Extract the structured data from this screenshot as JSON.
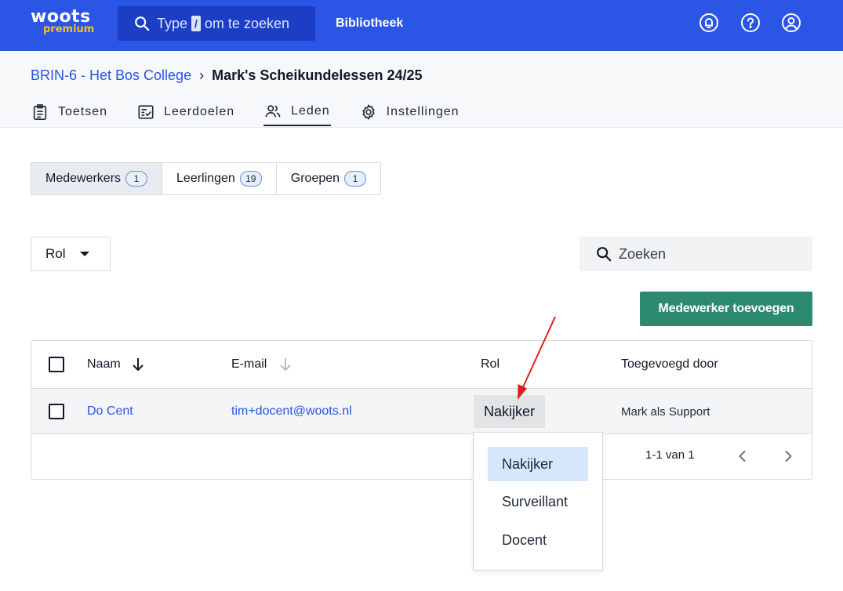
{
  "topbar": {
    "logo_main": "woots",
    "logo_sub": "premium",
    "search_prefix": "Type",
    "search_key": "/",
    "search_suffix": "om te zoeken",
    "nav_link": "Bibliotheek",
    "icons": [
      "notification-bell-icon",
      "help-icon",
      "account-icon"
    ]
  },
  "breadcrumb": {
    "parent": "BRIN-6 - Het Bos College",
    "separator": "›",
    "current": "Mark's Scheikundelessen 24/25"
  },
  "tabs": [
    {
      "label": "Toetsen",
      "icon": "clipboard-icon"
    },
    {
      "label": "Leerdoelen",
      "icon": "checklist-icon"
    },
    {
      "label": "Leden",
      "icon": "users-icon",
      "active": true
    },
    {
      "label": "Instellingen",
      "icon": "gear-icon"
    }
  ],
  "segments": [
    {
      "label": "Medewerkers",
      "count": "1",
      "active": true
    },
    {
      "label": "Leerlingen",
      "count": "19"
    },
    {
      "label": "Groepen",
      "count": "1"
    }
  ],
  "filter": {
    "label": "Rol"
  },
  "search": {
    "placeholder": "Zoeken"
  },
  "add_button": {
    "label": "Medewerker toevoegen"
  },
  "table": {
    "headers": {
      "name": "Naam",
      "email": "E-mail",
      "role": "Rol",
      "added_by": "Toegevoegd door"
    },
    "rows": [
      {
        "name": "Do Cent",
        "email": "tim+docent@woots.nl",
        "role": "Nakijker",
        "added_by": "Mark als Support"
      }
    ],
    "pagination": "1-1 van 1"
  },
  "dropdown": {
    "options": [
      "Nakijker",
      "Surveillant",
      "Docent"
    ],
    "selected": "Nakijker"
  },
  "colors": {
    "brand_blue": "#2a55e5",
    "logo_yellow": "#f4c21b",
    "primary_green": "#2c8a6f",
    "annotation_red": "#e11d1d"
  }
}
